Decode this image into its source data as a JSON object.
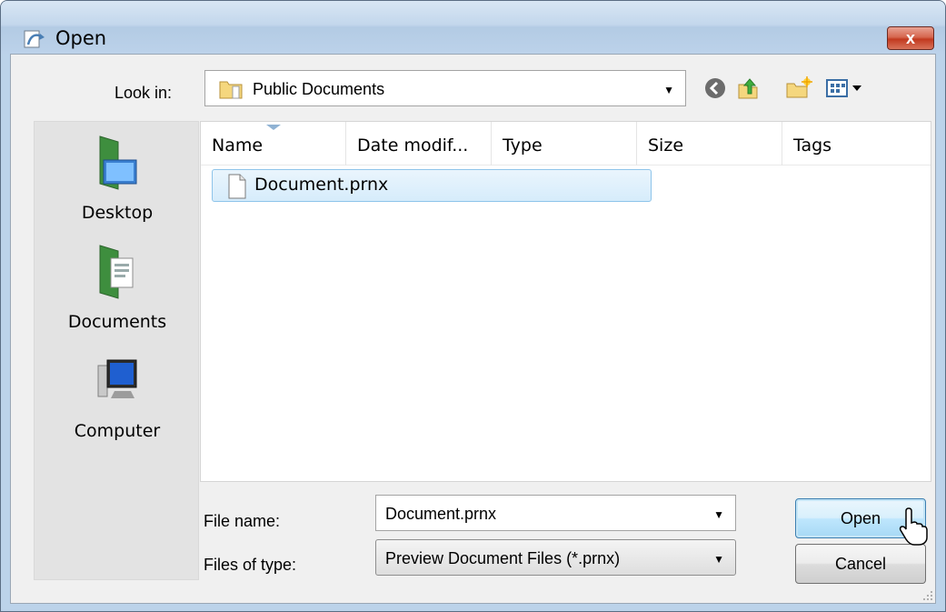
{
  "window": {
    "title": "Open",
    "close_label": "x"
  },
  "toolbar": {
    "lookin_label": "Look in:",
    "lookin_value": "Public Documents",
    "icons": [
      "back-icon",
      "up-folder-icon",
      "new-folder-icon",
      "views-menu-icon"
    ]
  },
  "places": [
    {
      "label": "Desktop",
      "icon": "desktop-icon"
    },
    {
      "label": "Documents",
      "icon": "documents-icon"
    },
    {
      "label": "Computer",
      "icon": "computer-icon"
    }
  ],
  "filelist": {
    "columns": [
      "Name",
      "Date modif...",
      "Type",
      "Size",
      "Tags"
    ],
    "files": [
      {
        "name": "Document.prnx",
        "icon": "document-icon",
        "selected": true
      }
    ]
  },
  "form": {
    "filename_label": "File name:",
    "filename_value": "Document.prnx",
    "filetype_label": "Files of type:",
    "filetype_value": "Preview Document Files (*.prnx)"
  },
  "buttons": {
    "open": "Open",
    "cancel": "Cancel"
  },
  "colors": {
    "title_bar": "#bcd2ea",
    "close_button": "#c2391f",
    "selection": "#d6ecfb",
    "default_button": "#bee6fd"
  }
}
